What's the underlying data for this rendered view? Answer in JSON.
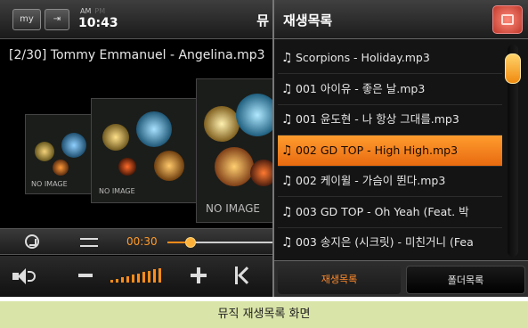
{
  "status_bar": {
    "my_button": "my",
    "am": "AM",
    "pm": "PM",
    "time": "10:43",
    "music_label": "뮤"
  },
  "now_playing": "[2/30] Tommy Emmanuel - Angelina.mp3",
  "covers": [
    {
      "label": "NO IMAGE"
    },
    {
      "label": "NO IMAGE"
    },
    {
      "label": "NO IMAGE"
    }
  ],
  "progress": {
    "elapsed": "00:30",
    "fraction": 0.22
  },
  "volume": {
    "level": 1.0,
    "bars": 10
  },
  "panel": {
    "title": "재생목록"
  },
  "playlist": [
    {
      "title": "Scorpions - Holiday.mp3",
      "active": false
    },
    {
      "title": "001  아이유 - 좋은 날.mp3",
      "active": false
    },
    {
      "title": "001  윤도현 - 나 항상 그대를.mp3",
      "active": false
    },
    {
      "title": "002  GD  TOP - High High.mp3",
      "active": true
    },
    {
      "title": "002  케이윌 - 가슴이 뛴다.mp3",
      "active": false
    },
    {
      "title": "003  GD  TOP - Oh Yeah (Feat. 박",
      "active": false
    },
    {
      "title": "003  송지은 (시크릿) - 미친거니 (Fea",
      "active": false
    }
  ],
  "tabs": {
    "playlist": "재생목록",
    "folder": "폴더목록"
  },
  "colors": {
    "accent": "#ff8a1a",
    "caption_bg": "#d9e4a8"
  },
  "caption": "뮤직 재생목록 화면"
}
